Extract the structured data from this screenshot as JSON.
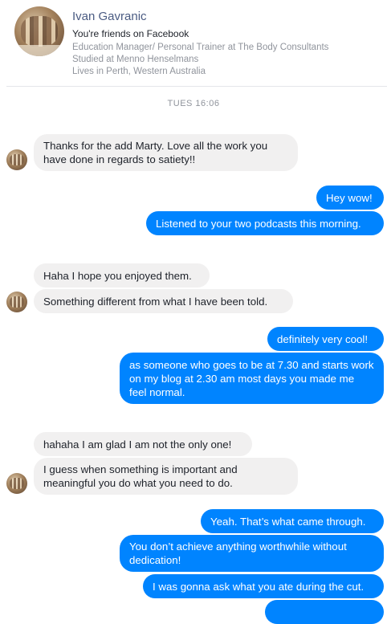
{
  "header": {
    "name": "Ivan Gavranic",
    "friends": "You're friends on Facebook",
    "line1": "Education Manager/ Personal Trainer at The Body Consultants",
    "line2": "Studied at Menno Henselmans",
    "line3": "Lives in Perth, Western Australia"
  },
  "timestamp": "TUES 16:06",
  "messages": [
    {
      "text": "Thanks for the add Marty. Love all the work you have done in regards to satiety!!"
    },
    {
      "text": "Hey wow!"
    },
    {
      "text": "Listened to your two podcasts this morning."
    },
    {
      "text": "Haha I hope you enjoyed them."
    },
    {
      "text": "Something different from what I have been told."
    },
    {
      "text": "definitely very cool!"
    },
    {
      "text": "as someone who goes to be at 7.30 and starts work on my blog at 2.30 am most days you made me feel normal."
    },
    {
      "text": "hahaha I am glad I am not the only one!"
    },
    {
      "text": "I guess when something is important and meaningful you do what you need to do."
    },
    {
      "text": "Yeah.  That’s what came through."
    },
    {
      "text": "You don’t achieve anything worthwhile without dedication!"
    },
    {
      "text": "I was gonna ask what you ate during the cut."
    }
  ]
}
